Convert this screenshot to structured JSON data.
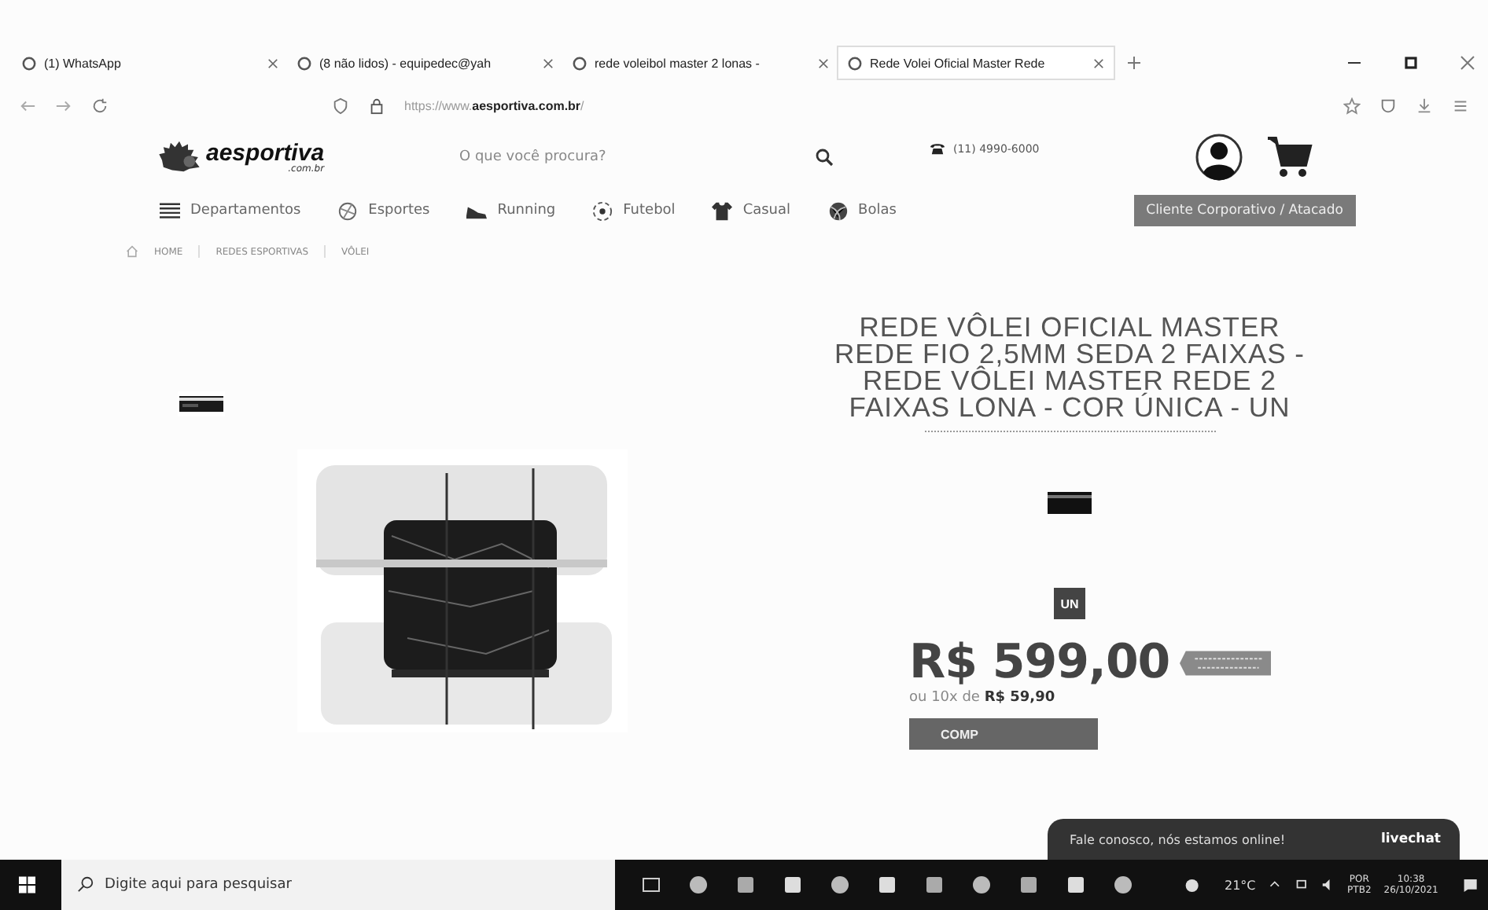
{
  "browser": {
    "tabs": [
      {
        "label": "(1) WhatsApp",
        "selected": false
      },
      {
        "label": "(8 não lidos) - equipedec@yah",
        "selected": false
      },
      {
        "label": "rede voleibol master 2 lonas - ",
        "selected": false
      },
      {
        "label": "Rede Volei Oficial Master Rede",
        "selected": true
      }
    ],
    "address": "https://www.**aesportiva.com.br**/"
  },
  "site": {
    "logo": "aesportiva",
    "logo_sub": ".com.br",
    "search_placeholder": "O que você procura?",
    "phone": "(11) 4990-6000",
    "nav": [
      {
        "label": "Departamentos",
        "kind": "menu"
      },
      {
        "label": "Esportes",
        "kind": "sports"
      },
      {
        "label": "Running",
        "kind": "shoe"
      },
      {
        "label": "Futebol",
        "kind": "soccer"
      },
      {
        "label": "Casual",
        "kind": "shirt"
      },
      {
        "label": "Bolas",
        "kind": "ball"
      }
    ],
    "corporate_button": "Cliente Corporativo / Atacado",
    "breadcrumb": [
      "HOME",
      "REDES ESPORTIVAS",
      "VÔLEI"
    ]
  },
  "product": {
    "title": "REDE VÔLEI OFICIAL MASTER REDE FIO 2,5MM SEDA 2 FAIXAS - REDE VÔLEI MASTER REDE 2 FAIXAS LONA - COR ÚNICA - UN",
    "size": "UN",
    "price": "R$ 599,00",
    "installments": "ou 10x de **R$ 59,90**",
    "buy_button": "COMP"
  },
  "chat": {
    "message": "Fale conosco, nós estamos online!",
    "brand": "livechat"
  },
  "taskbar": {
    "search_placeholder": "Digite aqui para pesquisar",
    "weather": "21°C",
    "language": "POR",
    "layout": "PTB2",
    "time": "10:38",
    "date": "26/10/2021"
  }
}
